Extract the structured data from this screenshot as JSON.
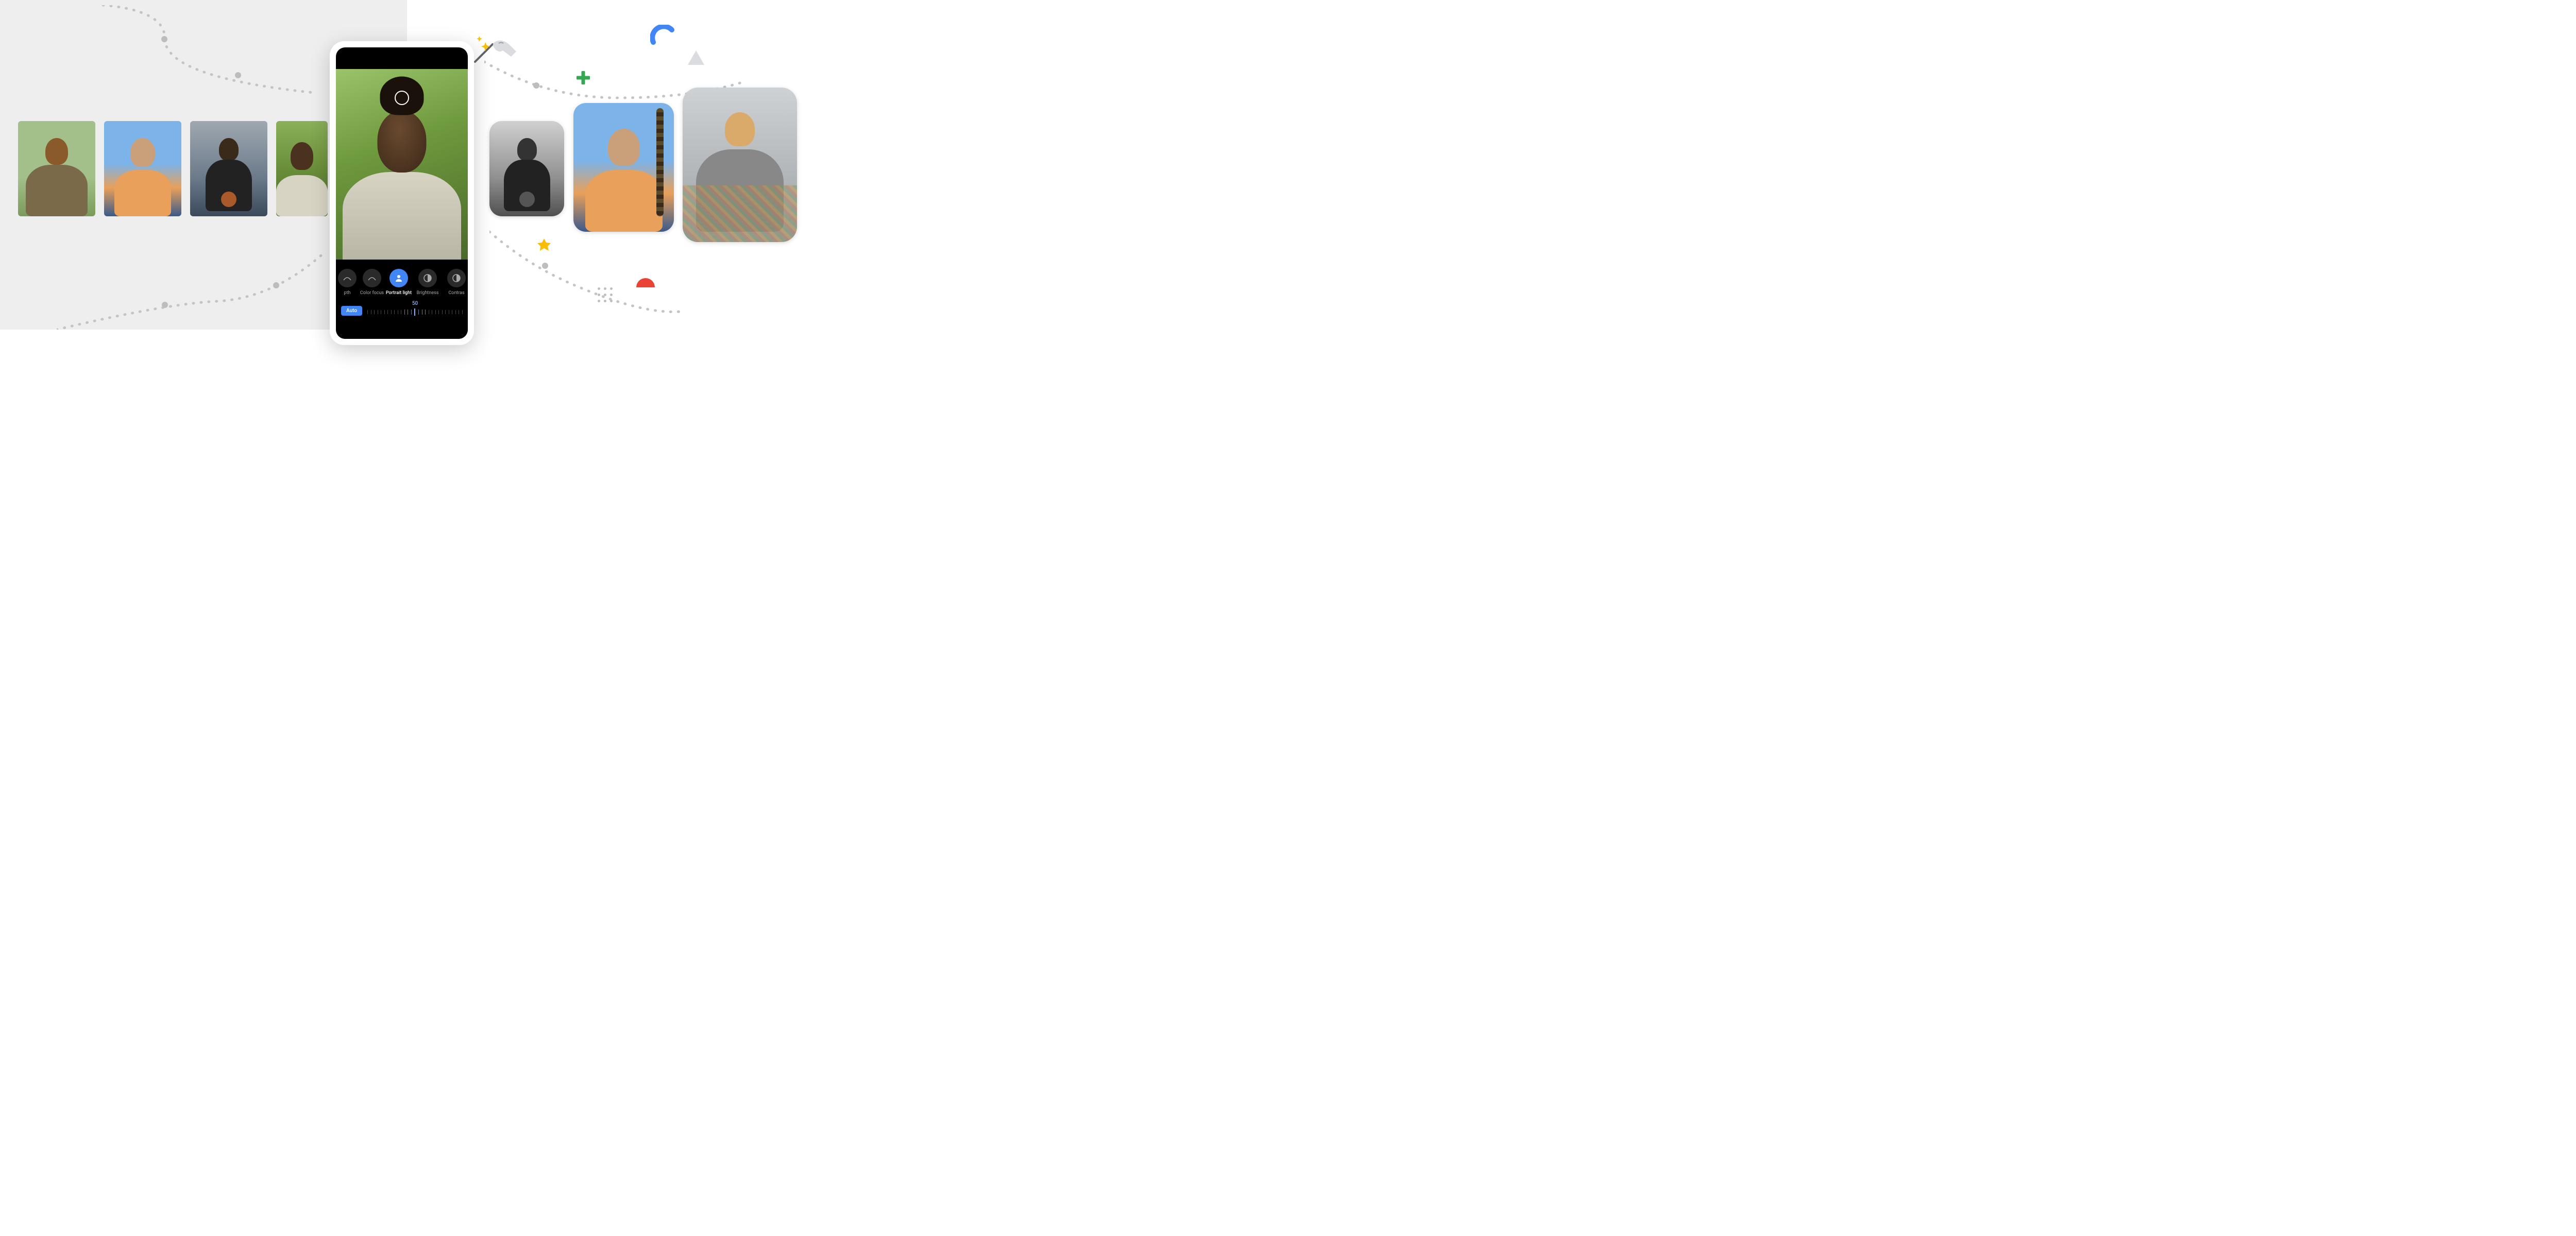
{
  "left_thumbs": [
    {
      "name": "hammock-portrait",
      "style": "hammock-color"
    },
    {
      "name": "girl-swing-portrait",
      "style": "girl"
    },
    {
      "name": "basketball-portrait",
      "style": "basketball"
    },
    {
      "name": "woman-portrait",
      "style": "main"
    }
  ],
  "right_thumbs": [
    {
      "name": "basketball-bw-portrait",
      "style": "basketball-bw"
    },
    {
      "name": "girl-swing-edited-portrait",
      "style": "girl"
    },
    {
      "name": "hammock-bw-portrait",
      "style": "hammock-bw"
    }
  ],
  "editor": {
    "tools": [
      {
        "key": "depth",
        "label": "pth",
        "icon": "arc"
      },
      {
        "key": "color_focus",
        "label": "Color focus",
        "icon": "arc"
      },
      {
        "key": "portrait_light",
        "label": "Portrait light",
        "icon": "person",
        "active": true
      },
      {
        "key": "brightness",
        "label": "Brightness",
        "icon": "contrast-half"
      },
      {
        "key": "contrast",
        "label": "Contras",
        "icon": "contrast"
      }
    ],
    "auto_label": "Auto",
    "slider_value": "50"
  },
  "colors": {
    "google_blue": "#4285f4",
    "google_red": "#ea4335",
    "google_yellow": "#fbbc04",
    "google_green": "#34a853"
  }
}
